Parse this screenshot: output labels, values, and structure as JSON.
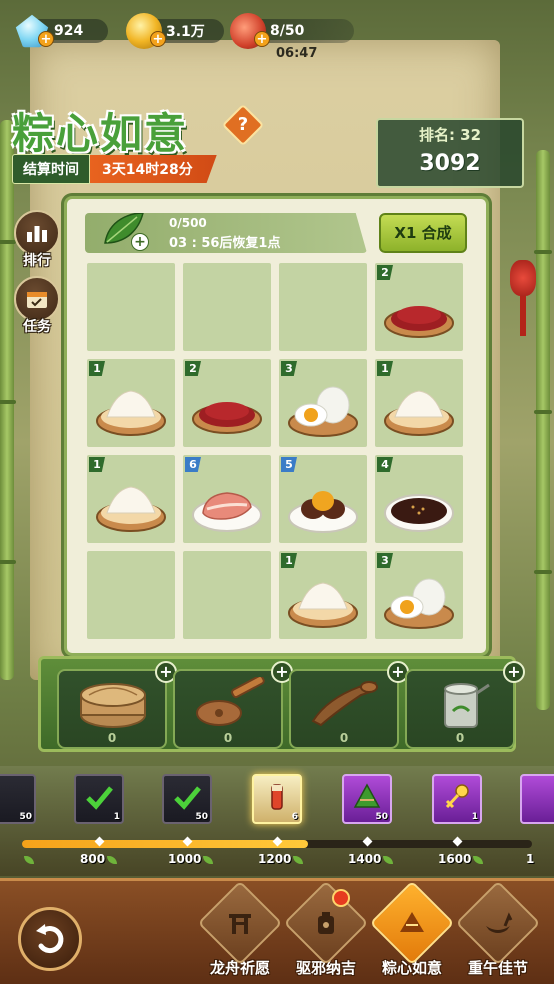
{
  "resources": {
    "gems": "924",
    "coins": "3.1万",
    "stamina": "8/50",
    "stamina_timer": "06:47"
  },
  "title": "粽心如意",
  "help_label": "?",
  "settle": {
    "label": "结算时间",
    "value": "3天14时28分"
  },
  "rank": {
    "label": "排名: 32",
    "score": "3092"
  },
  "side_buttons": [
    {
      "label": "排行",
      "icon": "bar-chart-icon"
    },
    {
      "label": "任务",
      "icon": "calendar-icon"
    }
  ],
  "energy": {
    "count": "0/500",
    "recover": "03 : 56后恢复1点",
    "plus": "+"
  },
  "merge_button": "X1 合成",
  "grid": [
    [
      {
        "badge": "",
        "food": ""
      },
      {
        "badge": "",
        "food": ""
      },
      {
        "badge": "",
        "food": ""
      },
      {
        "badge": "2",
        "food": "red-beans",
        "blue": false
      }
    ],
    [
      {
        "badge": "1",
        "food": "rice",
        "blue": false
      },
      {
        "badge": "2",
        "food": "red-beans",
        "blue": false
      },
      {
        "badge": "3",
        "food": "salted-egg",
        "blue": false
      },
      {
        "badge": "1",
        "food": "rice",
        "blue": false
      }
    ],
    [
      {
        "badge": "1",
        "food": "rice",
        "blue": false
      },
      {
        "badge": "6",
        "food": "pork",
        "blue": true
      },
      {
        "badge": "5",
        "food": "chestnut",
        "blue": true
      },
      {
        "badge": "4",
        "food": "bean-paste",
        "blue": false
      }
    ],
    [
      {
        "badge": "",
        "food": ""
      },
      {
        "badge": "",
        "food": ""
      },
      {
        "badge": "1",
        "food": "rice",
        "blue": false
      },
      {
        "badge": "3",
        "food": "salted-egg",
        "blue": false
      }
    ]
  ],
  "tools": [
    {
      "name": "steamer",
      "count": "0"
    },
    {
      "name": "spatula",
      "count": "0"
    },
    {
      "name": "ladle",
      "count": "0"
    },
    {
      "name": "pot",
      "count": "0"
    }
  ],
  "rewards": [
    {
      "count": "50",
      "style": "dark",
      "claimed": true
    },
    {
      "count": "1",
      "style": "dark",
      "claimed": true
    },
    {
      "count": "50",
      "style": "dark",
      "claimed": true
    },
    {
      "count": "6",
      "style": "gold",
      "claimed": false
    },
    {
      "count": "50",
      "style": "purple",
      "claimed": false
    },
    {
      "count": "1",
      "style": "purple",
      "claimed": false
    },
    {
      "count": "",
      "style": "purple",
      "claimed": false
    }
  ],
  "progress": {
    "fraction": 0.56
  },
  "milestones": [
    "800",
    "1000",
    "1200",
    "1400",
    "1600",
    "1"
  ],
  "nav": [
    {
      "label": "龙舟祈愿",
      "active": false,
      "dot": false
    },
    {
      "label": "驱邪纳吉",
      "active": false,
      "dot": true
    },
    {
      "label": "粽心如意",
      "active": true,
      "dot": false
    },
    {
      "label": "重午佳节",
      "active": false,
      "dot": false
    }
  ],
  "colors": {
    "accent": "#e8631f",
    "title_green": "#49a03a",
    "board_bg": "#f0eed9",
    "cell_bg": "#c3d3a3"
  }
}
